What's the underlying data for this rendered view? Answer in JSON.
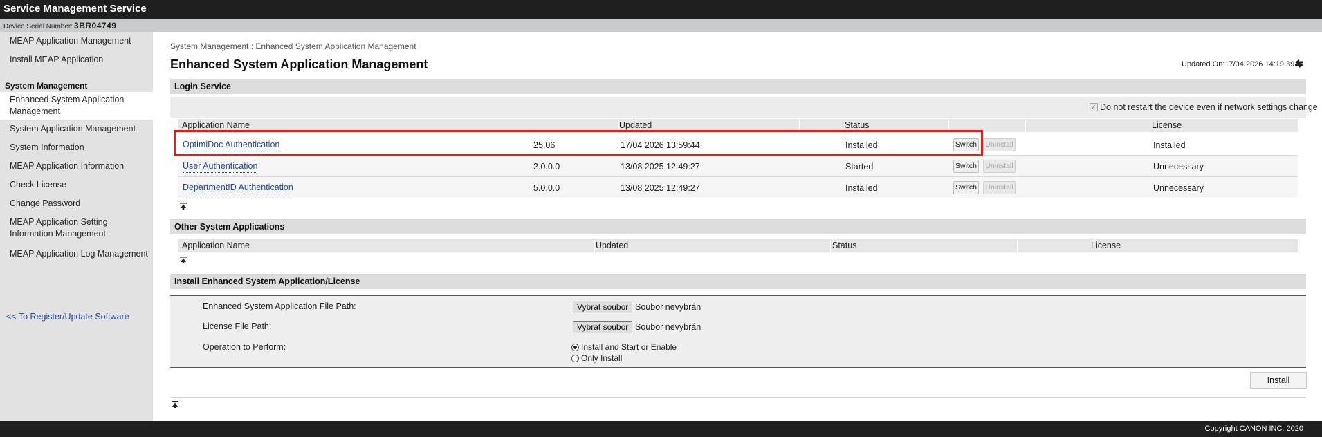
{
  "app": {
    "title": "Service Management Service"
  },
  "device": {
    "serial_label": "Device Serial Number:",
    "serial": "3BR04749"
  },
  "sidebar": {
    "items": [
      {
        "label": "MEAP Application Management"
      },
      {
        "label": "Install MEAP Application"
      }
    ],
    "section": "System Management",
    "sys_items": [
      {
        "label_line1": "Enhanced System Application",
        "label_line2": "Management",
        "active": true
      },
      {
        "label": "System Application Management"
      },
      {
        "label": "System Information"
      },
      {
        "label": "MEAP Application Information"
      },
      {
        "label": "Check License"
      },
      {
        "label": "Change Password"
      },
      {
        "label_line1": "MEAP Application Setting",
        "label_line2": "Information Management"
      },
      {
        "label": "MEAP Application Log Management"
      }
    ],
    "register_link": "<< To Register/Update Software"
  },
  "main": {
    "breadcrumb": "System Management : Enhanced System Application Management",
    "title": "Enhanced System Application Management",
    "updated_on": "Updated On:17/04 2026 14:19:39",
    "login_service": {
      "heading": "Login Service",
      "no_restart_label": "Do not restart the device even if network settings change",
      "no_restart_checked": true,
      "columns": [
        "Application Name",
        "Updated",
        "Status",
        "License"
      ],
      "rows": [
        {
          "name": "OptimiDoc Authentication",
          "version": "25.06",
          "updated": "17/04 2026 13:59:44",
          "status": "Installed",
          "switch": "Switch",
          "uninstall": "Uninstall",
          "license": "Installed"
        },
        {
          "name": "User Authentication",
          "version": "2.0.0.0",
          "updated": "13/08 2025 12:49:27",
          "status": "Started",
          "switch": "Switch",
          "uninstall": "Uninstall",
          "license": "Unnecessary"
        },
        {
          "name": "DepartmentID Authentication",
          "version": "5.0.0.0",
          "updated": "13/08 2025 12:49:27",
          "status": "Installed",
          "switch": "Switch",
          "uninstall": "Uninstall",
          "license": "Unnecessary"
        }
      ]
    },
    "other_apps": {
      "heading": "Other System Applications",
      "columns": [
        "Application Name",
        "Updated",
        "Status",
        "License"
      ]
    },
    "install": {
      "heading": "Install Enhanced System Application/License",
      "app_path_label": "Enhanced System Application File Path:",
      "license_path_label": "License File Path:",
      "operation_label": "Operation to Perform:",
      "browse_label": "Vybrat soubor",
      "no_file_label": "Soubor nevybrán",
      "options": [
        "Install and Start or Enable",
        "Only Install"
      ],
      "selected_option": "Install and Start or Enable",
      "install_button": "Install"
    }
  },
  "footer": {
    "copyright": "Copyright CANON INC. 2020"
  },
  "colors": {
    "highlight": "#e02020",
    "link": "#1f4b9a",
    "bar": "#1f1f1f"
  }
}
